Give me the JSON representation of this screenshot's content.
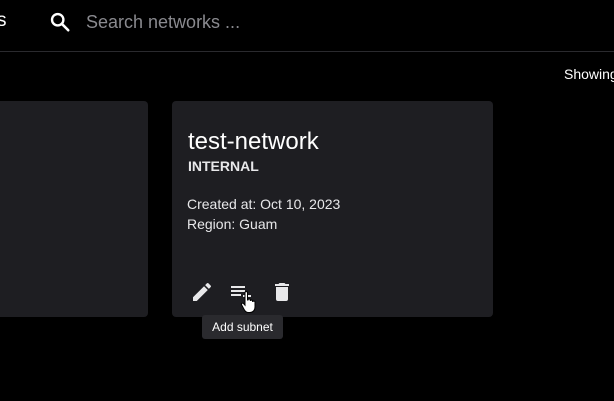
{
  "header": {
    "cut_text": "s",
    "search_placeholder": "Search networks ..."
  },
  "status": {
    "showing_text": "Showing"
  },
  "cards": [
    {
      "title": "test-network",
      "type": "INTERNAL",
      "created": "Created at: Oct 10, 2023",
      "region": "Region: Guam",
      "actions": [
        {
          "icon": "pencil-icon"
        },
        {
          "icon": "add-subnet-icon"
        },
        {
          "icon": "trash-icon"
        }
      ]
    }
  ],
  "tooltip": {
    "text": "Add subnet"
  },
  "colors": {
    "background": "#000000",
    "card": "#1e1e22",
    "tooltip": "#2a2a2e",
    "placeholder": "#8a8a8f",
    "icon": "#e8e8ea"
  }
}
